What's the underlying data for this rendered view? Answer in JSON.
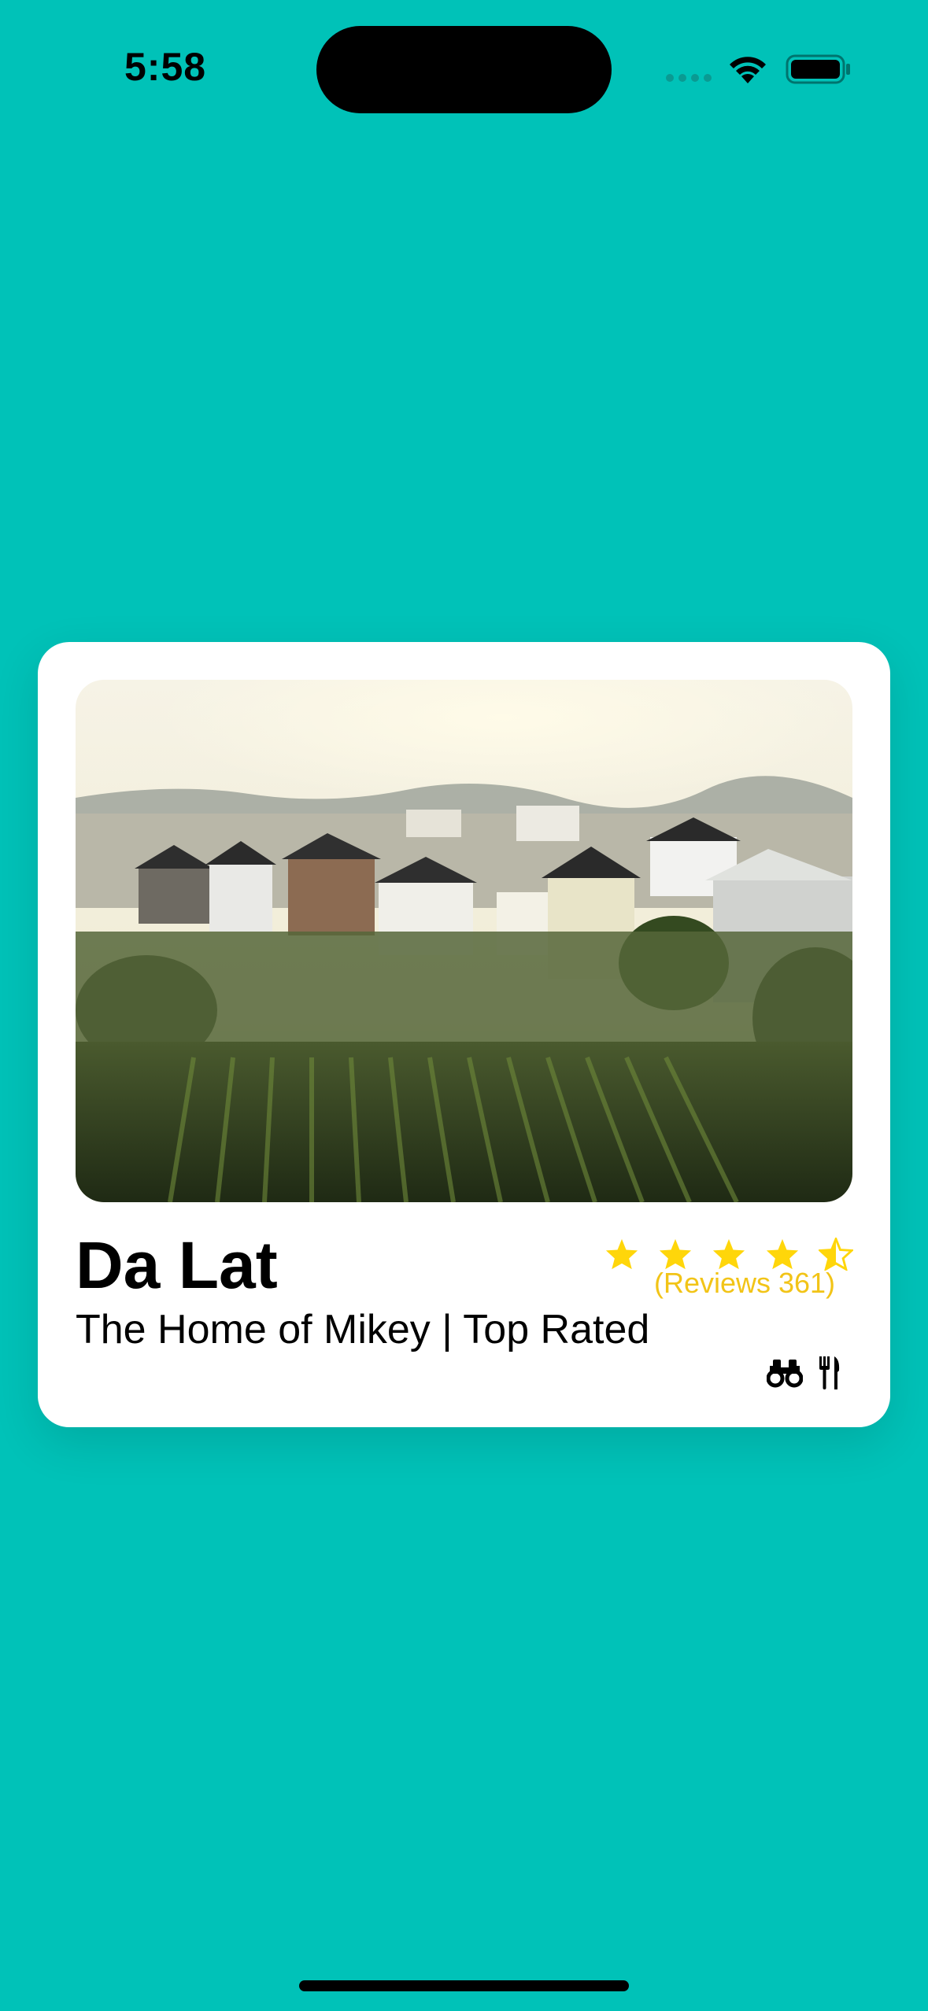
{
  "status_bar": {
    "time": "5:58"
  },
  "card": {
    "title": "Da Lat",
    "subtitle": "The Home of Mikey | Top Rated",
    "rating": {
      "stars": 4.5,
      "reviews_text": "(Reviews 361)",
      "color": "#FFD60A"
    },
    "icons": [
      "binoculars-icon",
      "fork-knife-icon"
    ]
  },
  "colors": {
    "background": "#00C2B8",
    "card": "#FFFFFF",
    "accent": "#F2C417"
  }
}
